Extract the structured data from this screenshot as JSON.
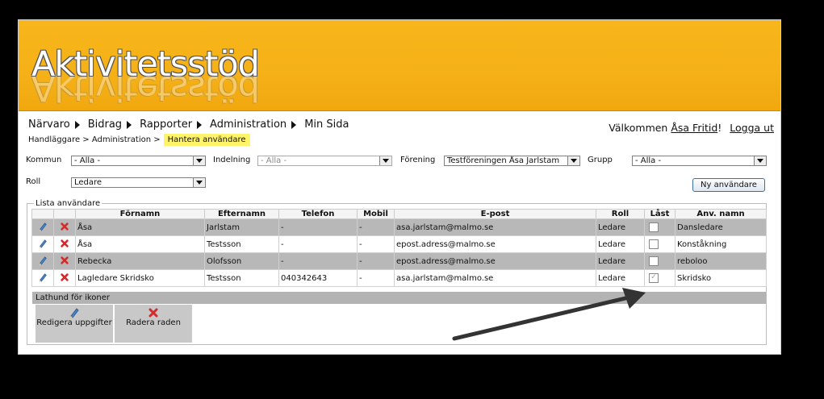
{
  "app": {
    "logo": "Aktivitetsstöd"
  },
  "nav": {
    "items": [
      {
        "label": "Närvaro"
      },
      {
        "label": "Bidrag"
      },
      {
        "label": "Rapporter"
      },
      {
        "label": "Administration"
      },
      {
        "label": "Min Sida"
      }
    ]
  },
  "welcome": {
    "prefix": "Välkommen",
    "user": "Åsa Fritid",
    "suffix": "!",
    "logout": "Logga ut"
  },
  "breadcrumb": {
    "part1": "Handläggare",
    "sep1": ">",
    "part2": "Administration",
    "sep2": ">",
    "current": "Hantera användare"
  },
  "filters": {
    "kommun": {
      "label": "Kommun",
      "value": "- Alla -"
    },
    "indelning": {
      "label": "Indelning",
      "value": "- Alla -"
    },
    "forening": {
      "label": "Förening",
      "value": "Testföreningen Åsa Jarlstam"
    },
    "grupp": {
      "label": "Grupp",
      "value": "- Alla -"
    },
    "roll": {
      "label": "Roll",
      "value": "Ledare"
    }
  },
  "new_user_button": "Ny användare",
  "list": {
    "legend": "Lista användare",
    "columns": [
      "Förnamn",
      "Efternamn",
      "Telefon",
      "Mobil",
      "E-post",
      "Roll",
      "Låst",
      "Anv. namn"
    ],
    "rows": [
      {
        "fornamn": "Åsa",
        "efternamn": "Jarlstam",
        "telefon": "-",
        "mobil": "-",
        "epost": "asa.jarlstam@malmo.se",
        "roll": "Ledare",
        "last": false,
        "anvnamn": "Dansledare"
      },
      {
        "fornamn": "Åsa",
        "efternamn": "Testsson",
        "telefon": "-",
        "mobil": "-",
        "epost": "epost.adress@malmo.se",
        "roll": "Ledare",
        "last": false,
        "anvnamn": "Konståkning"
      },
      {
        "fornamn": "Rebecka",
        "efternamn": "Olofsson",
        "telefon": "-",
        "mobil": "-",
        "epost": "epost.adress@malmo.se",
        "roll": "Ledare",
        "last": false,
        "anvnamn": "reboloo"
      },
      {
        "fornamn": "Lagledare Skridsko",
        "efternamn": "Testsson",
        "telefon": "040342643",
        "mobil": "-",
        "epost": "asa.jarlstam@malmo.se",
        "roll": "Ledare",
        "last": true,
        "anvnamn": "Skridsko"
      }
    ]
  },
  "legend_icons": {
    "title": "Lathund för ikoner",
    "edit": "Redigera uppgifter",
    "delete": "Radera raden"
  },
  "colors": {
    "banner": "#f5b117",
    "highlight": "#fff36a",
    "row_alt": "#b8b8b8"
  },
  "icons": {
    "edit": "pencil-icon",
    "delete": "red-x-icon"
  }
}
